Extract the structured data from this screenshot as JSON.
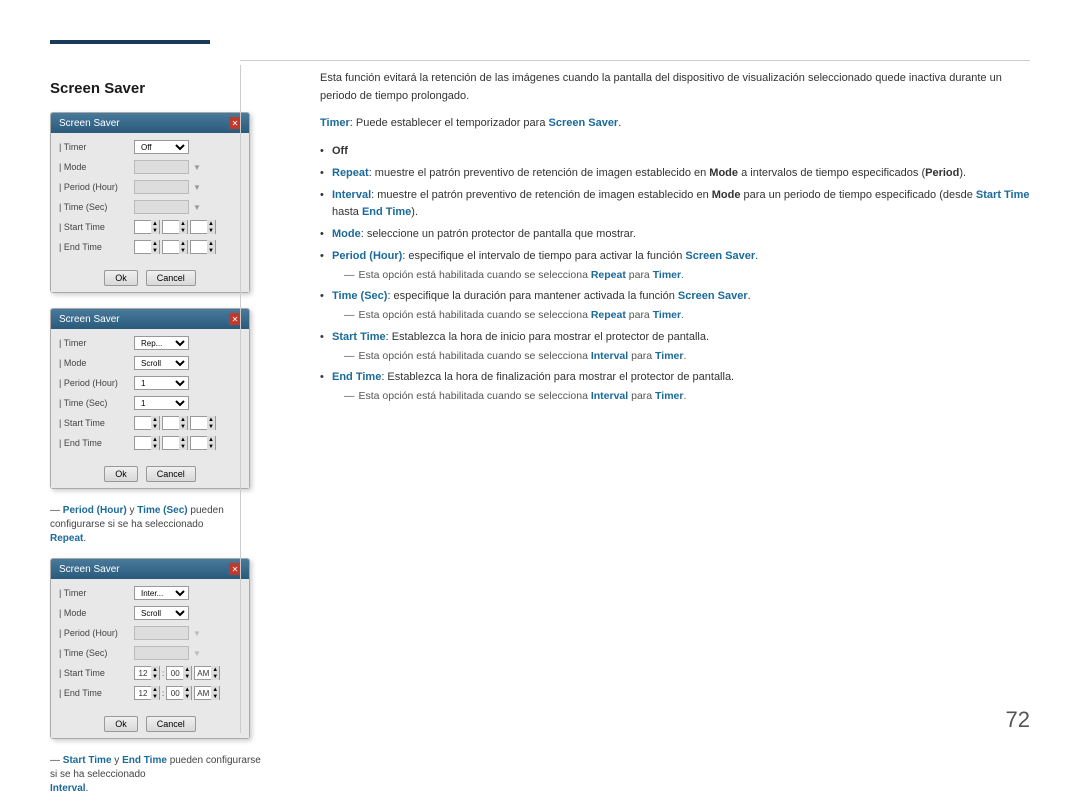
{
  "page": {
    "number": "72"
  },
  "section": {
    "title": "Screen Saver"
  },
  "right_col": {
    "intro": "Esta función evitará la retención de las imágenes cuando la pantalla del dispositivo de visualización seleccionado quede inactiva durante un periodo de tiempo prolongado.",
    "timer_label": "Timer",
    "timer_desc": ": Puede establecer el temporizador para ",
    "timer_link": "Screen Saver",
    "bullets": [
      {
        "id": "off",
        "text_plain": "Off"
      },
      {
        "id": "repeat",
        "bold_start": "Repeat",
        "text": ": muestre el patrón preventivo de retención de imagen establecido en ",
        "bold_mid": "Mode",
        "text2": " a intervalos de tiempo especificados (",
        "bold_end": "Period",
        "text3": ")."
      },
      {
        "id": "interval",
        "bold_start": "Interval",
        "text": ": muestre el patrón preventivo de retención de imagen establecido en ",
        "bold_mid": "Mode",
        "text2": " para un periodo de tiempo especificado (desde ",
        "bold_start2": "Start Time",
        "text3": " hasta ",
        "bold_end": "End Time",
        "text4": ")."
      },
      {
        "id": "mode",
        "bold_start": "Mode",
        "text": ": seleccione un patrón protector de pantalla que mostrar."
      },
      {
        "id": "period",
        "bold_start": "Period (Hour)",
        "text": ": especifique el intervalo de tiempo para activar la función ",
        "bold_end": "Screen Saver",
        "text2": ".",
        "subnote": "Esta opción está habilitada cuando se selecciona ",
        "subnote_bold": "Repeat",
        "subnote_text": " para ",
        "subnote_bold2": "Timer",
        "subnote_text2": "."
      },
      {
        "id": "time-sec",
        "bold_start": "Time (Sec)",
        "text": ": especifique la duración para mantener activada la función ",
        "bold_end": "Screen Saver",
        "text2": ".",
        "subnote": "Esta opción está habilitada cuando se selecciona ",
        "subnote_bold": "Repeat",
        "subnote_text": " para ",
        "subnote_bold2": "Timer",
        "subnote_text2": "."
      },
      {
        "id": "start-time",
        "bold_start": "Start Time",
        "text": ": Establezca la hora de inicio para mostrar el protector de pantalla.",
        "subnote": "Esta opción está habilitada cuando se selecciona ",
        "subnote_bold": "Interval",
        "subnote_text": " para ",
        "subnote_bold2": "Timer",
        "subnote_text2": "."
      },
      {
        "id": "end-time",
        "bold_start": "End Time",
        "text": ": Establezca la hora de finalización para mostrar el protector de pantalla.",
        "subnote": "Esta opción está habilitada cuando se selecciona ",
        "subnote_bold": "Interval",
        "subnote_text": " para ",
        "subnote_bold2": "Timer",
        "subnote_text2": "."
      }
    ]
  },
  "dialogs": [
    {
      "id": "dialog1",
      "title": "Screen Saver",
      "rows": [
        {
          "label": "| Timer",
          "control": "select",
          "value": "Off",
          "disabled": false
        },
        {
          "label": "| Mode",
          "control": "input-disabled",
          "value": "",
          "disabled": true
        },
        {
          "label": "| Period (Hour)",
          "control": "input-disabled",
          "value": "",
          "disabled": true
        },
        {
          "label": "| Time (Sec)",
          "control": "input-disabled",
          "value": "",
          "disabled": true
        },
        {
          "label": "| Start Time",
          "control": "spinner3",
          "disabled": true
        },
        {
          "label": "| End Time",
          "control": "spinner3",
          "disabled": true
        }
      ],
      "buttons": [
        "Ok",
        "Cancel"
      ]
    },
    {
      "id": "dialog2",
      "title": "Screen Saver",
      "rows": [
        {
          "label": "| Timer",
          "control": "select",
          "value": "Rep..."
        },
        {
          "label": "| Mode",
          "control": "select",
          "value": "Scroll"
        },
        {
          "label": "| Period (Hour)",
          "control": "select",
          "value": "1"
        },
        {
          "label": "| Time (Sec)",
          "control": "select",
          "value": "1"
        },
        {
          "label": "| Start Time",
          "control": "spinner3",
          "disabled": true
        },
        {
          "label": "| End Time",
          "control": "spinner3",
          "disabled": true
        }
      ],
      "buttons": [
        "Ok",
        "Cancel"
      ]
    },
    {
      "id": "dialog3",
      "title": "Screen Saver",
      "rows": [
        {
          "label": "| Timer",
          "control": "select",
          "value": "Inter..."
        },
        {
          "label": "| Mode",
          "control": "select",
          "value": "Scroll"
        },
        {
          "label": "| Period (Hour)",
          "control": "input-disabled",
          "value": ""
        },
        {
          "label": "| Time (Sec)",
          "control": "input-disabled",
          "value": ""
        },
        {
          "label": "| Start Time",
          "control": "spinner3-active",
          "v1": "12",
          "v2": "00",
          "v3": "AM"
        },
        {
          "label": "| End Time",
          "control": "spinner3-active",
          "v1": "12",
          "v2": "00",
          "v3": "AM"
        }
      ],
      "buttons": [
        "Ok",
        "Cancel"
      ]
    }
  ],
  "notes": [
    {
      "id": "note1",
      "prefix": "",
      "dash": "—",
      "text_plain": " ",
      "bold1": "Period (Hour)",
      "mid": " y ",
      "bold2": "Time (Sec)",
      "text": " pueden configurarse si se ha seleccionado",
      "bold3": "Repeat",
      "text2": "."
    },
    {
      "id": "note2",
      "prefix": "",
      "dash": "—",
      "bold1": "Start Time",
      "mid": " y ",
      "bold2": "End Time",
      "text": " pueden configurarse si se ha seleccionado",
      "bold3": "Interval",
      "text2": "."
    }
  ],
  "labels": {
    "ok": "Ok",
    "cancel": "Cancel",
    "screen_saver": "Screen Saver"
  }
}
